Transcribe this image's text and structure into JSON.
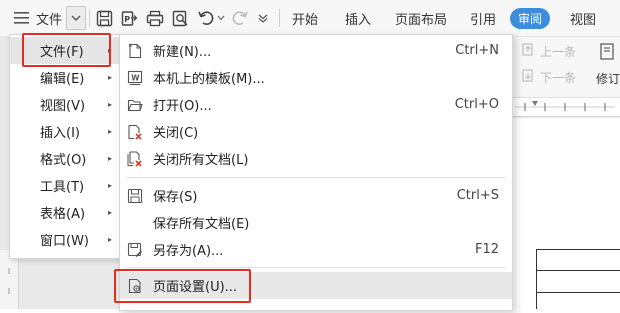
{
  "toolbar": {
    "file_label": "文件",
    "tabs": [
      {
        "label": "开始"
      },
      {
        "label": "插入"
      },
      {
        "label": "页面布局"
      },
      {
        "label": "引用"
      },
      {
        "label": "审阅",
        "active": true
      },
      {
        "label": "视图"
      }
    ],
    "icons": [
      "hamburger-icon",
      "save-icon",
      "export-icon",
      "print-icon",
      "preview-icon",
      "undo-icon",
      "redo-icon",
      "more-icon"
    ]
  },
  "ribbon_right": {
    "prev_label": "上一条",
    "next_label": "下一条",
    "revise_label": "修订"
  },
  "menu_level1": {
    "items": [
      {
        "label": "文件(F)",
        "selected": true
      },
      {
        "label": "编辑(E)"
      },
      {
        "label": "视图(V)"
      },
      {
        "label": "插入(I)"
      },
      {
        "label": "格式(O)"
      },
      {
        "label": "工具(T)"
      },
      {
        "label": "表格(A)"
      },
      {
        "label": "窗口(W)"
      }
    ]
  },
  "menu_file": {
    "items": [
      {
        "label": "新建(N)...",
        "shortcut": "Ctrl+N",
        "icon": "new-doc-icon"
      },
      {
        "label": "本机上的模板(M)...",
        "shortcut": "",
        "icon": "template-icon"
      },
      {
        "label": "打开(O)...",
        "shortcut": "Ctrl+O",
        "icon": "folder-open-icon"
      },
      {
        "label": "关闭(C)",
        "shortcut": "",
        "icon": "close-doc-icon"
      },
      {
        "label": "关闭所有文档(L)",
        "shortcut": "",
        "icon": "close-all-icon"
      },
      {
        "label": "保存(S)",
        "shortcut": "Ctrl+S",
        "icon": "save-icon"
      },
      {
        "label": "保存所有文档(E)",
        "shortcut": "",
        "icon": ""
      },
      {
        "label": "另存为(A)...",
        "shortcut": "F12",
        "icon": "save-as-icon"
      },
      {
        "label": "页面设置(U)...",
        "shortcut": "",
        "icon": "page-setup-icon",
        "highlighted": true
      }
    ]
  },
  "colors": {
    "accent": "#3c8dde",
    "highlight_box": "#e42d22",
    "red_icon": "#e03a2f"
  }
}
